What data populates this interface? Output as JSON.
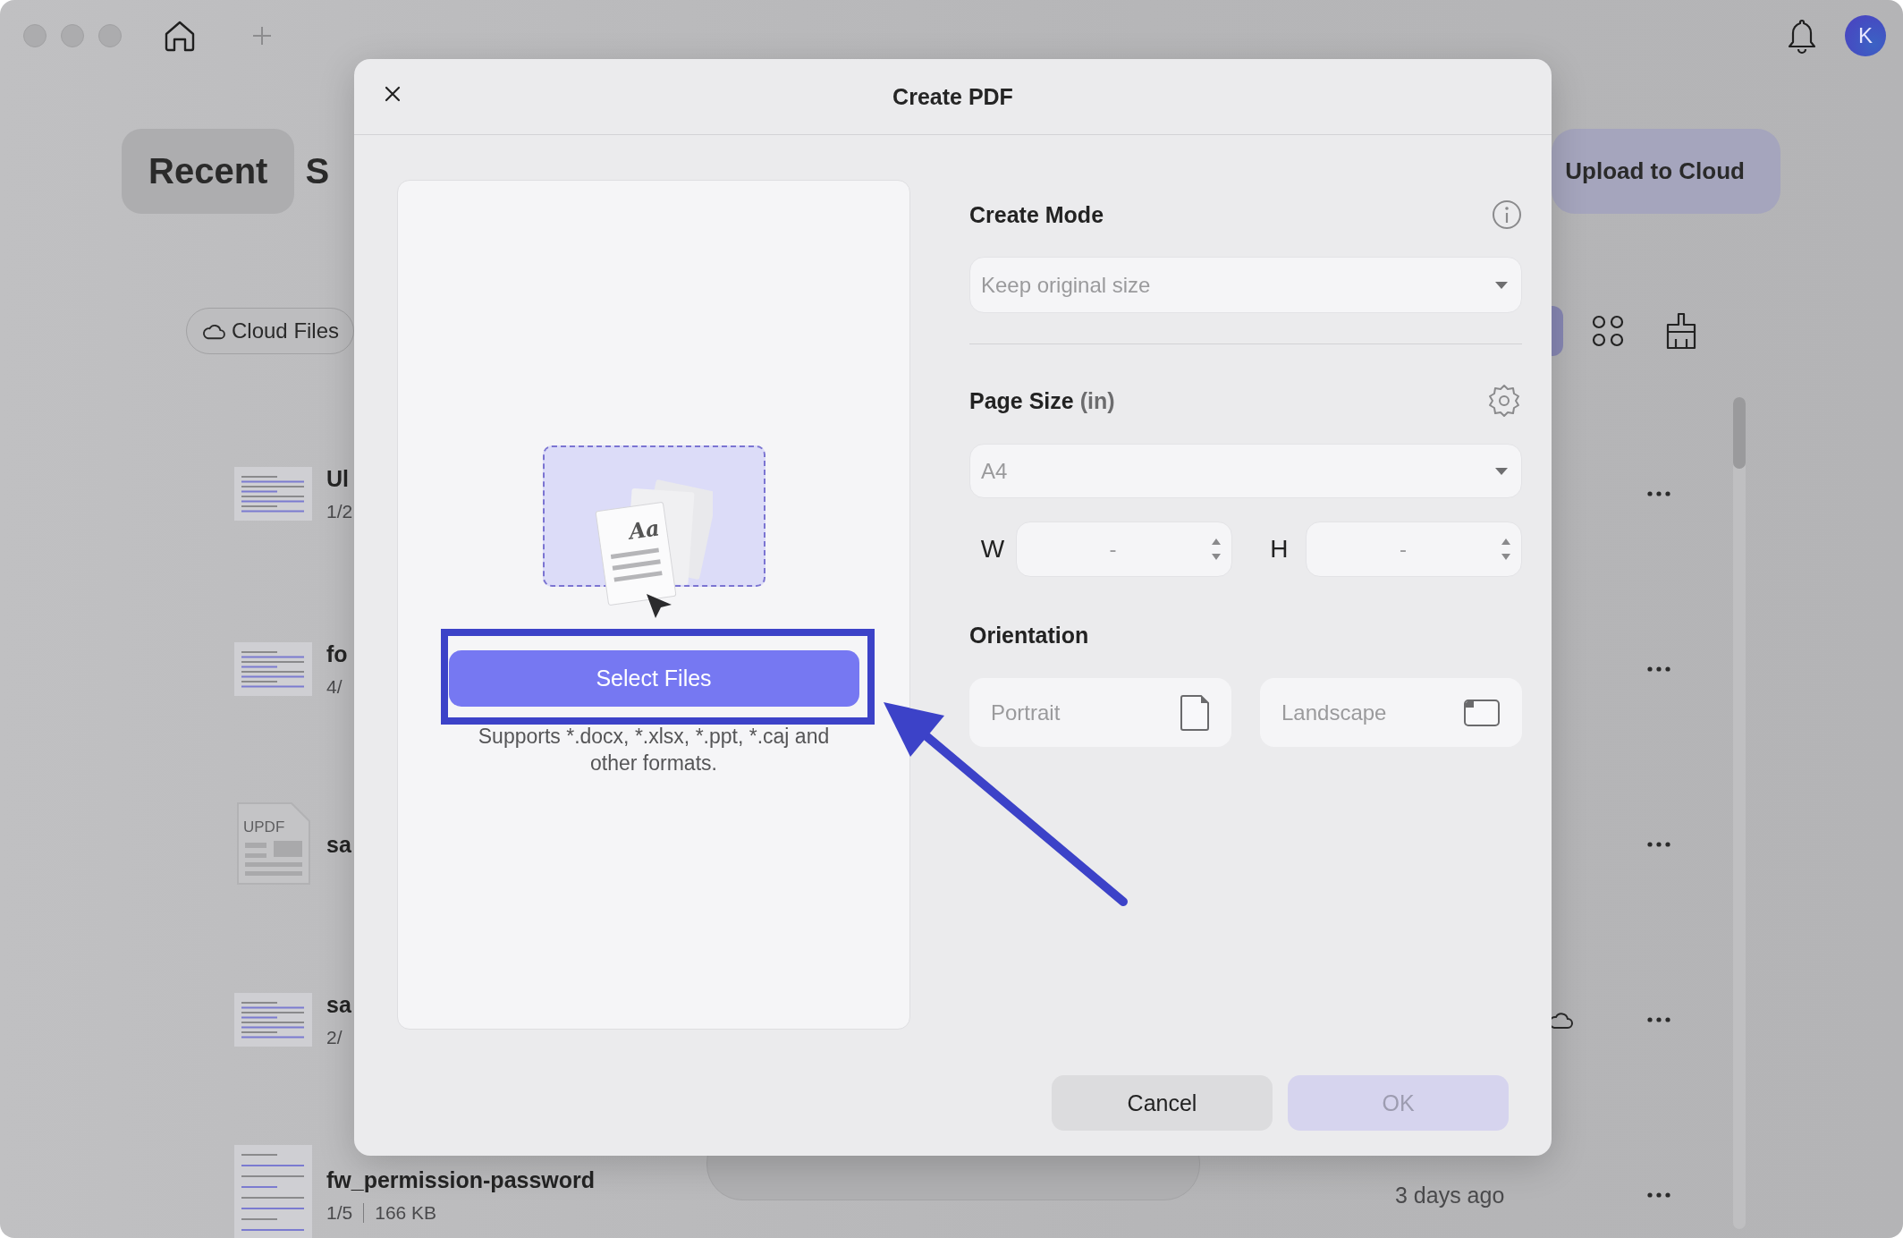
{
  "top_bar": {
    "avatar_initial": "K"
  },
  "tabs": [
    {
      "label": "Recent",
      "selected": true
    },
    {
      "label": "S",
      "selected": false
    }
  ],
  "upload_button": {
    "label": "Upload to Cloud"
  },
  "filter": {
    "label": "Cloud Files"
  },
  "files": [
    {
      "kind": "page",
      "name": "Ul",
      "meta": "1/2",
      "synced": false
    },
    {
      "kind": "page",
      "name": "fo",
      "meta": "4/",
      "synced": false
    },
    {
      "kind": "placeholder",
      "thumb_label": "UPDF",
      "name": "sa",
      "synced": false
    },
    {
      "kind": "page",
      "name": "sa",
      "meta": "2/",
      "synced": true
    },
    {
      "kind": "page",
      "name": "fw_permission-password",
      "pages": "1/5",
      "size": "166 KB",
      "time": "3 days ago",
      "synced": false
    }
  ],
  "dialog": {
    "title": "Create PDF",
    "drop_zone": {
      "illustration_label": "Aa",
      "button": "Select Files",
      "hint": "Supports *.docx, *.xlsx, *.ppt, *.caj and other formats."
    },
    "create_mode": {
      "label": "Create Mode",
      "value": "Keep original size"
    },
    "page_size": {
      "label": "Page Size",
      "unit": "(in)",
      "value": "A4",
      "width": {
        "label": "W",
        "value": "-"
      },
      "height": {
        "label": "H",
        "value": "-"
      }
    },
    "orientation": {
      "label": "Orientation",
      "options": [
        {
          "kind": "portrait",
          "label": "Portrait",
          "selected": false
        },
        {
          "kind": "landscape",
          "label": "Landscape",
          "selected": false
        }
      ]
    },
    "buttons": [
      {
        "label": "Cancel",
        "disabled": false
      },
      {
        "label": "OK",
        "disabled": true
      }
    ]
  }
}
